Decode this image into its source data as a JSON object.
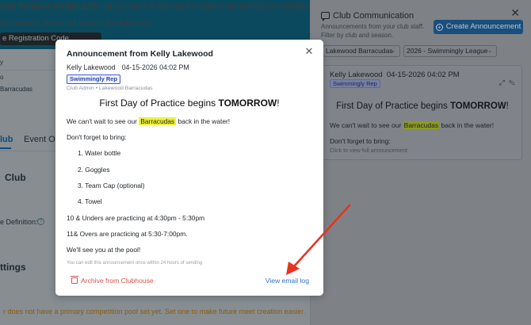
{
  "background": {
    "banner_line1_bold": "your Families on Mar 27th",
    "banner_line1_rest": " - (If you need to change this date email team@swimmingly.app)",
    "banner_line2": "instructions and email to your swim families:",
    "code_button": "e Registration Code",
    "row_label_1": "y",
    "row_label_2": "o",
    "row_label_3": "Barracudas",
    "tab_club": "lub",
    "tab_events": "Event Or",
    "section_club": "Club",
    "definition_label": "e Definition:",
    "help_icon": "?",
    "section_settings": "ttings",
    "warning": "r does not have a primary competition pool set yet. Set one to make future meet creation easier."
  },
  "drawer": {
    "title": "Club Communication",
    "subtitle1": "Announcements from your club staff.",
    "subtitle2": "Filter by club and season.",
    "create_button": "Create Announcement",
    "club_select": "Lakewood Barracudas",
    "season_select": "2026 - Swimmingly League",
    "card": {
      "author": "Kelly Lakewood",
      "date": "04-15-2026 04:02 PM",
      "badge": "Swimmingly Rep",
      "title_plain": "First Day of Practice begins ",
      "title_bold": "TOMORROW",
      "title_end": "!",
      "body_pre": "We can't wait to see our ",
      "body_hl": "Barracudas",
      "body_post": " back in the water!",
      "body2": "Don't forget to bring:",
      "click_hint": "Click to view full announcement"
    }
  },
  "modal": {
    "title": "Announcement from Kelly Lakewood",
    "author": "Kelly Lakewood",
    "date": "04-15-2026 04:02 PM",
    "badge": "Swimmingly Rep",
    "club_line": "Club Admin • Lakewood Barracudas",
    "headline_plain": "First Day of Practice begins ",
    "headline_bold": "TOMORROW",
    "headline_end": "!",
    "p1_pre": "We can't wait to see our ",
    "p1_hl": "Barracudas",
    "p1_post": " back in the water!",
    "p2": "Don't forget to bring:",
    "list": [
      "1. Water bottle",
      "2. Goggles",
      "3. Team Cap (optional)",
      "4. Towel"
    ],
    "p3": "10 & Unders are practicing at 4:30pm - 5:30pm",
    "p4": "11& Overs are practicing at 5:30-7:00pm.",
    "p5": "We'll see you at the pool!",
    "edit_note": "You can edit this announcement once within 24 hours of sending",
    "archive_label": "Archive from Clubhouse",
    "log_label": "View email log",
    "close_glyph": "✕"
  },
  "colors": {
    "accent_blue": "#2f6fd1",
    "danger_red": "#d9534f",
    "highlight_yellow": "#eef13a",
    "arrow_red": "#e8331f"
  }
}
